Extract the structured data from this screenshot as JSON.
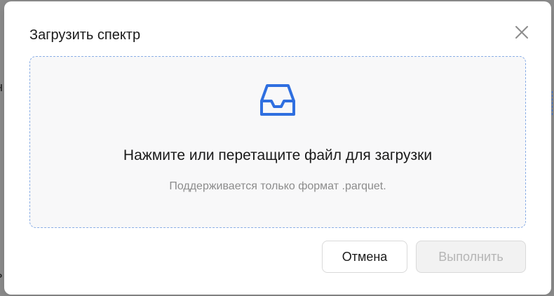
{
  "modal": {
    "title": "Загрузить спектр",
    "close_icon": "close-icon"
  },
  "dropzone": {
    "icon": "inbox-icon",
    "title": "Нажмите или перетащите файл для загрузки",
    "hint": "Поддерживается только формат .parquet."
  },
  "footer": {
    "cancel_label": "Отмена",
    "submit_label": "Выполнить"
  },
  "colors": {
    "accent": "#2f6fe0",
    "dropzone_border": "#8aaee6",
    "disabled_text": "#b5b5b5"
  }
}
